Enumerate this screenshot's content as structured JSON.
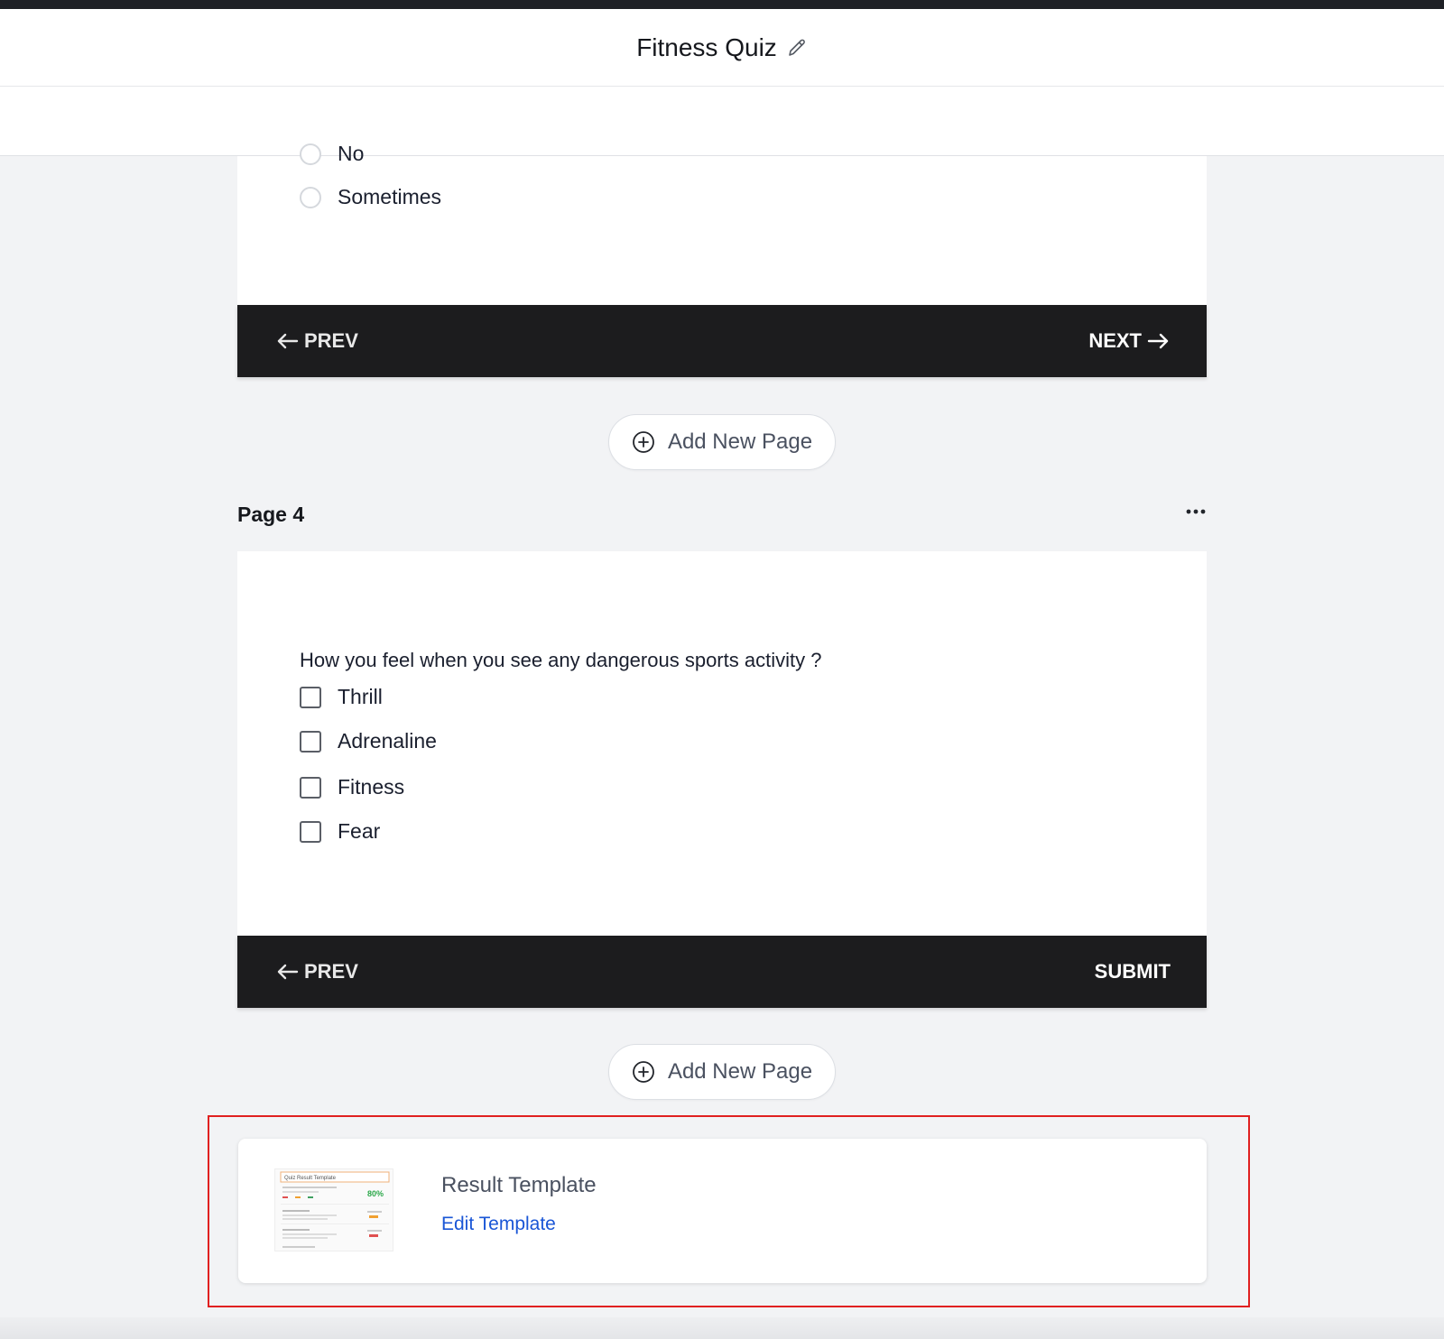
{
  "header": {
    "title": "Fitness Quiz",
    "edit_icon": "pencil-icon"
  },
  "page3": {
    "options": [
      "No",
      "Sometimes"
    ],
    "nav": {
      "prev_label": "PREV",
      "next_label": "NEXT"
    }
  },
  "add_page": {
    "label": "Add New Page",
    "icon": "plus-circle-icon"
  },
  "page4": {
    "label": "Page 4",
    "menu_icon": "more-horizontal-icon",
    "question": "How you feel when you see any dangerous sports activity ?",
    "options": [
      "Thrill",
      "Adrenaline",
      "Fitness",
      "Fear"
    ],
    "nav": {
      "prev_label": "PREV",
      "submit_label": "SUBMIT"
    }
  },
  "result_template": {
    "title": "Result Template",
    "edit_label": "Edit Template",
    "thumbnail": {
      "heading": "Quiz Result Template",
      "score": "80%",
      "score_color": "#2ca84a"
    }
  },
  "colors": {
    "nav_bar": "#1c1c1e",
    "link": "#1a56d6",
    "highlight_border": "#e02020"
  }
}
